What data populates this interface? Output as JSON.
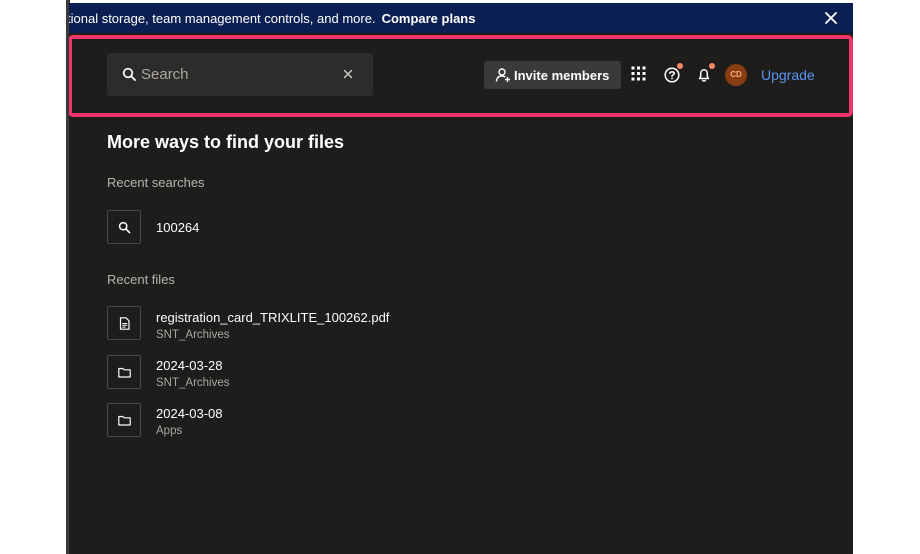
{
  "banner": {
    "text": "tional storage, team management controls, and more.",
    "link": "Compare plans",
    "close_icon": "close-icon"
  },
  "search": {
    "placeholder": "Search",
    "value": "",
    "icon": "search-icon",
    "clear_icon": "clear-icon"
  },
  "header": {
    "invite_label": "Invite members",
    "invite_icon": "add-person-icon",
    "apps_icon": "app-grid-icon",
    "help_icon": "help-icon",
    "bell_icon": "bell-icon",
    "avatar_initials": "CD",
    "upgrade_label": "Upgrade"
  },
  "main": {
    "title": "More ways to find your files",
    "recent_searches_heading": "Recent searches",
    "recent_searches": [
      {
        "query": "100264",
        "icon": "search-icon"
      }
    ],
    "recent_files_heading": "Recent files",
    "recent_files": [
      {
        "name": "registration_card_TRIXLITE_100262.pdf",
        "location": "SNT_Archives",
        "icon": "pdf-file-icon"
      },
      {
        "name": "2024-03-28",
        "location": "SNT_Archives",
        "icon": "folder-icon"
      },
      {
        "name": "2024-03-08",
        "location": "Apps",
        "icon": "folder-icon"
      }
    ]
  },
  "colors": {
    "banner_bg": "#0b1f52",
    "app_bg": "#1e1d1c",
    "highlight": "#f0356b",
    "link": "#5b93f0",
    "notification_dot": "#f58b5c",
    "avatar_bg": "#8a3d12"
  }
}
